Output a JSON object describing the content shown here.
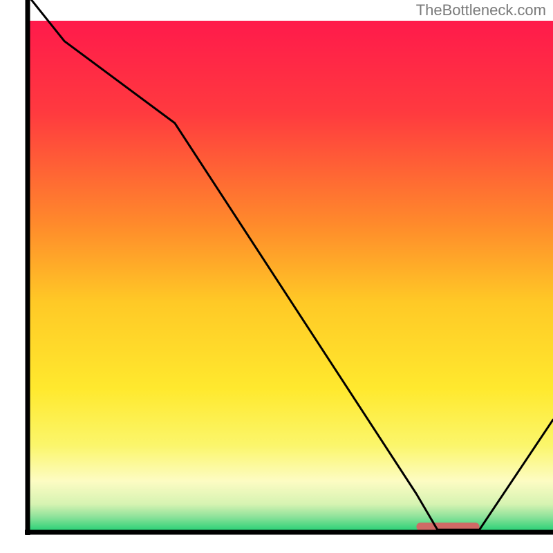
{
  "attribution": "TheBottleneck.com",
  "chart_data": {
    "type": "line",
    "title": "",
    "xlabel": "",
    "ylabel": "",
    "xlim": [
      0,
      100
    ],
    "ylim": [
      0,
      100
    ],
    "x": [
      0,
      7,
      28,
      74,
      78,
      86,
      100
    ],
    "values": [
      105,
      96,
      80,
      7.5,
      0.5,
      0.5,
      22
    ],
    "optimum_range_x": [
      74,
      86
    ],
    "gradient_stops": [
      {
        "pos": 0.0,
        "color": "#ff1a4b"
      },
      {
        "pos": 0.18,
        "color": "#ff3a3f"
      },
      {
        "pos": 0.4,
        "color": "#ff8b2b"
      },
      {
        "pos": 0.55,
        "color": "#ffc926"
      },
      {
        "pos": 0.72,
        "color": "#ffe92e"
      },
      {
        "pos": 0.83,
        "color": "#fbf66b"
      },
      {
        "pos": 0.9,
        "color": "#fdfcc3"
      },
      {
        "pos": 0.945,
        "color": "#d6f3b2"
      },
      {
        "pos": 0.97,
        "color": "#8de29a"
      },
      {
        "pos": 1.0,
        "color": "#1ecf72"
      }
    ],
    "optimum_marker_color": "#cf6a66"
  }
}
